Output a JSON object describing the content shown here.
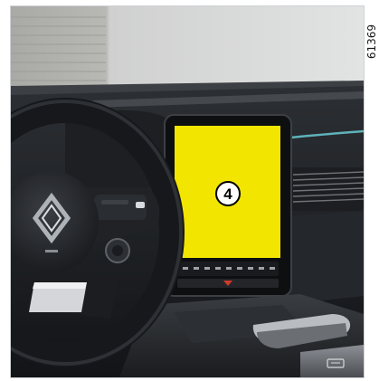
{
  "figure": {
    "reference_code": "61369",
    "callout_number": "4",
    "highlight_color": "#f2e500"
  },
  "icons": {
    "steering_wheel": "steering-wheel",
    "brand_logo": "diamond-logo",
    "dashboard": "dashboard",
    "multimedia_screen": "multimedia-screen-highlight",
    "air_vent": "air-vent",
    "gear_selector": "gear-selector",
    "phone_tray": "phone-charging-tray"
  }
}
